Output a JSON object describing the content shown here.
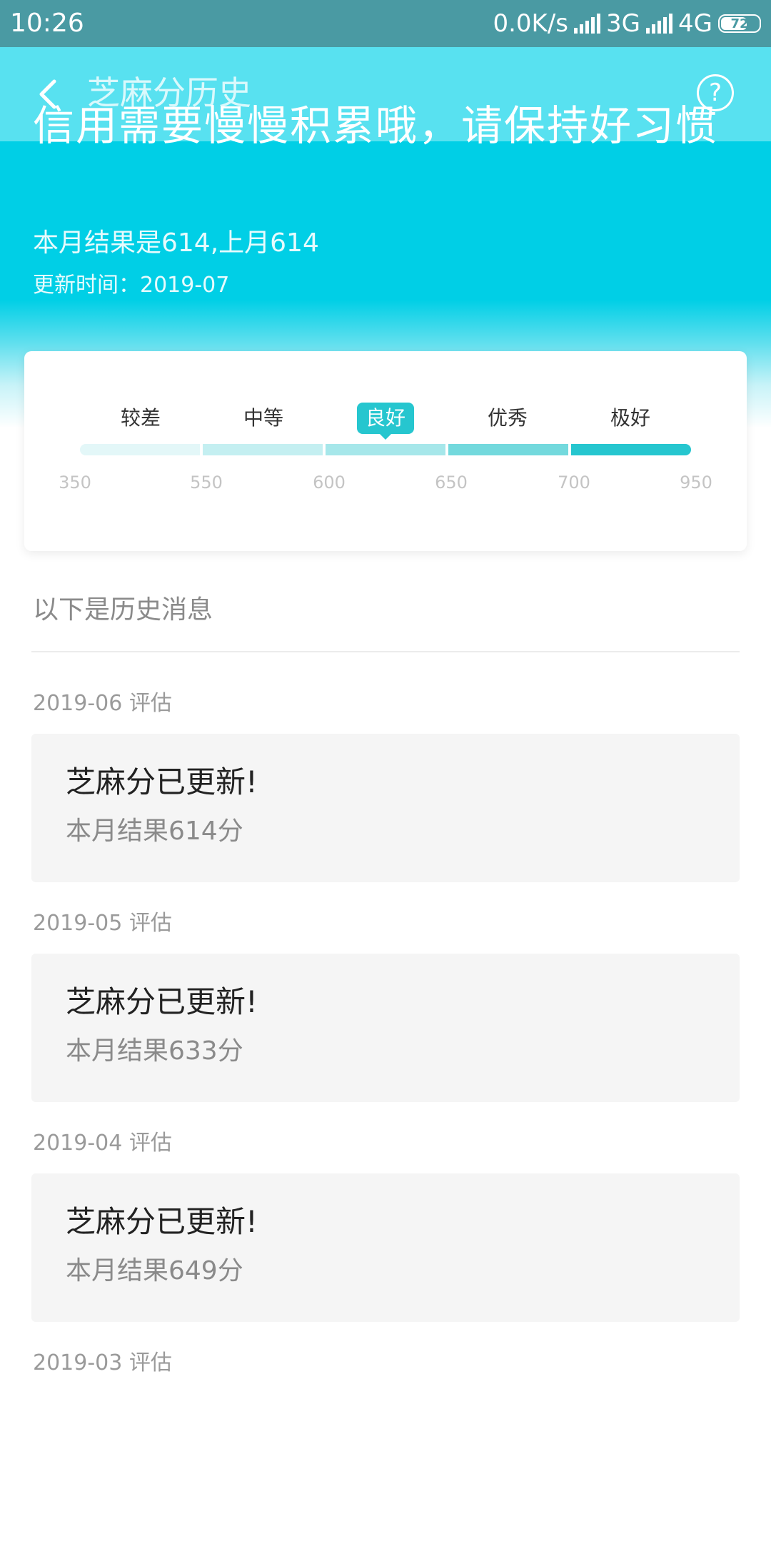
{
  "status_bar": {
    "time": "10:26",
    "net_speed": "0.0K/s",
    "net_type_1": "3G",
    "net_type_2": "4G",
    "battery": "72"
  },
  "header": {
    "title": "芝麻分历史",
    "back_icon": "back-arrow-icon",
    "help_icon": "question-circle-icon",
    "help_symbol": "?"
  },
  "hero": {
    "headline": "信用需要慢慢积累哦，请保持好习惯",
    "summary": "本月结果是614,上月614",
    "update_time": "更新时间：2019-07"
  },
  "score_range": {
    "levels": [
      "较差",
      "中等",
      "良好",
      "优秀",
      "极好"
    ],
    "active_level": "良好",
    "ticks": [
      "350",
      "550",
      "600",
      "650",
      "700",
      "950"
    ],
    "segment_colors": [
      "#e3f7f8",
      "#c4eff1",
      "#a6e7ea",
      "#73d9dd",
      "#26c6cf"
    ]
  },
  "history": {
    "intro": "以下是历史消息",
    "entries": [
      {
        "date": "2019-06 评估",
        "title": "芝麻分已更新!",
        "desc": "本月结果614分"
      },
      {
        "date": "2019-05 评估",
        "title": "芝麻分已更新!",
        "desc": "本月结果633分"
      },
      {
        "date": "2019-04 评估",
        "title": "芝麻分已更新!",
        "desc": "本月结果649分"
      },
      {
        "date": "2019-03 评估"
      }
    ]
  }
}
